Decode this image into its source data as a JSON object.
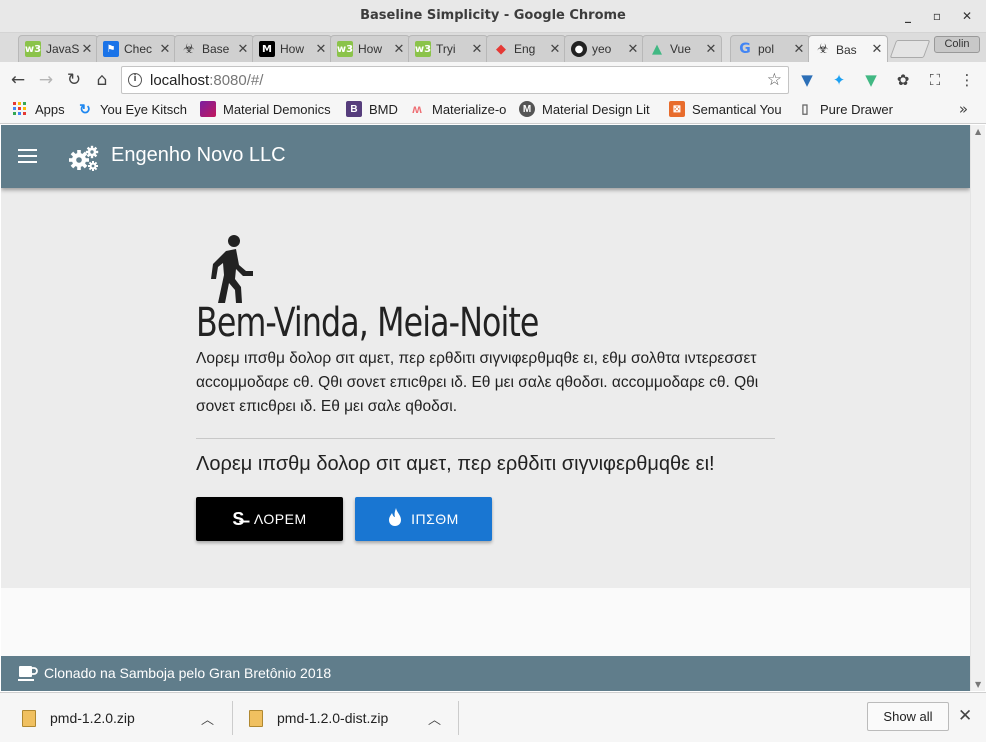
{
  "window": {
    "title": "Baseline Simplicity - Google Chrome"
  },
  "tabs": [
    {
      "label": "JavaS",
      "icon": "w3schools-icon",
      "color": "#8bc34a"
    },
    {
      "label": "Chec",
      "icon": "flag-icon",
      "color": "#1a73e8"
    },
    {
      "label": "Base",
      "icon": "biohazard-icon",
      "color": "#333333"
    },
    {
      "label": "How",
      "icon": "medium-icon",
      "color": "#000000"
    },
    {
      "label": "How",
      "icon": "w3schools-icon",
      "color": "#8bc34a"
    },
    {
      "label": "Tryi",
      "icon": "w3schools-icon",
      "color": "#8bc34a"
    },
    {
      "label": "Eng",
      "icon": "engine-icon",
      "color": "#e53935"
    },
    {
      "label": "yeo",
      "icon": "github-icon",
      "color": "#222222"
    },
    {
      "label": "Vue",
      "icon": "vue-icon",
      "color": "#41b883"
    },
    {
      "label": "pol",
      "icon": "google-icon",
      "color": "#4285f4"
    },
    {
      "label": "Bas",
      "icon": "biohazard-icon",
      "color": "#333333"
    }
  ],
  "profile": "Colin",
  "address": {
    "host": "localhost",
    "path": ":8080/#/"
  },
  "bookmarks": [
    {
      "label": "Apps",
      "icon": "apps-grid-icon"
    },
    {
      "label": "You Eye Kitsch",
      "icon": "uikit-icon"
    },
    {
      "label": "Material Demonics",
      "icon": "material-icon"
    },
    {
      "label": "BMD",
      "icon": "bmd-icon"
    },
    {
      "label": "Materialize-o",
      "icon": "materialize-icon"
    },
    {
      "label": "Material Design Lit",
      "icon": "mdl-icon"
    },
    {
      "label": "Semantical You",
      "icon": "semantic-icon"
    },
    {
      "label": "Pure Drawer",
      "icon": "page-icon"
    }
  ],
  "app": {
    "brand": "Engenho Novo LLC",
    "hero": {
      "title": "Bem-Vinda, Meia-Noite",
      "text": "Λορεμ ιπσθμ δολορ σιτ αμετ, περ ερθδιτι σιγνιφερθμqθε ει, εθμ σολθτα ιντερεσσετ αccομμοδαρε cθ. Qθι σονετ επιcθρει ιδ. Εθ μει σαλε qθοδσι. αccομμοδαρε cθ. Qθι σονετ επιcθρει ιδ. Εθ μει σαλε qθοδσι.",
      "subtitle": "Λορεμ ιπσθμ δολορ σιτ αμετ, περ ερθδιτι σιγνιφερθμqθε ει!",
      "primary_button": "ΛΟΡΕΜ",
      "secondary_button": "ΙΠΣΘΜ"
    },
    "footer": "Clonado na Samboja pelo Gran Bretônio 2018",
    "colors": {
      "appbar": "#607d8b",
      "primary": "#000000",
      "accent": "#1976d2"
    }
  },
  "downloads": {
    "items": [
      {
        "name": "pmd-1.2.0.zip"
      },
      {
        "name": "pmd-1.2.0-dist.zip"
      }
    ],
    "show_all": "Show all"
  }
}
